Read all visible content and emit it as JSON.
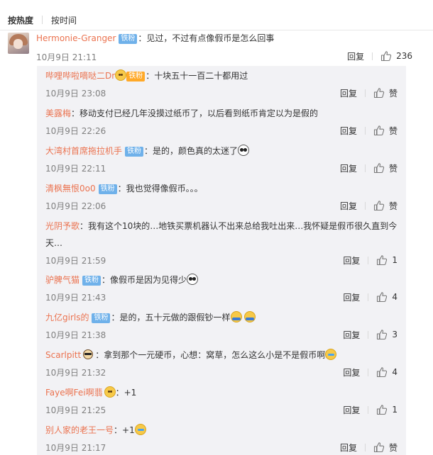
{
  "sort": {
    "hot": "按热度",
    "time": "按时间"
  },
  "main": {
    "user": "Hermonie-Granger",
    "badge": "铁粉",
    "text": "：见过，不过有点像假币是怎么回事",
    "time": "10月9日 21:11",
    "reply": "回复",
    "likes": "236"
  },
  "replies": [
    {
      "user": "哔哩哔啦嘀哒二Dr",
      "badge": "铁粉",
      "badge_style": "gold",
      "text": "：十块五十一百二十都用过",
      "time": "10月9日 23:08",
      "reply": "回复",
      "likes": "赞"
    },
    {
      "user": "美露梅",
      "badge": "",
      "text": "：移动支付已经几年没摸过纸币了，以后看到纸币肯定以为是假的",
      "time": "10月9日 22:26",
      "reply": "回复",
      "likes": "赞"
    },
    {
      "user": "大湾村首席拖拉机手",
      "badge": "铁粉",
      "text": "：是的，颜色真的太迷了",
      "emoji": "panda-icon",
      "time": "10月9日 22:11",
      "reply": "回复",
      "likes": "赞"
    },
    {
      "user": "清枫無恨0o0",
      "badge": "铁粉",
      "text": "：我也觉得像假币。。。",
      "time": "10月9日 22:06",
      "reply": "回复",
      "likes": "赞"
    },
    {
      "user": "光阴予歌",
      "badge": "",
      "text": "：我有这个10块的…地铁买票机器认不出来总给我吐出来…我怀疑是假币很久直到今",
      "text2": "天…",
      "time": "10月9日 21:59",
      "reply": "回复",
      "likes": "1"
    },
    {
      "user": "驴脾气猫",
      "badge": "铁粉",
      "text": "：像假币是因为见得少",
      "emoji": "panda-icon",
      "time": "10月9日 21:43",
      "reply": "回复",
      "likes": "4"
    },
    {
      "user": "九亿girls的",
      "badge": "铁粉",
      "text": "：是的，五十元做的跟假钞一样",
      "emoji": "hug-icon",
      "time": "10月9日 21:38",
      "reply": "回复",
      "likes": "3"
    },
    {
      "user": "Scarlpitt",
      "badge": "",
      "text": "：拿到那个一元硬币，心想：窝草，怎么这么小是不是假币啊",
      "emoji": "cry-laugh-icon",
      "time": "10月9日 21:32",
      "reply": "回复",
      "likes": "4"
    },
    {
      "user": "Faye啊Fei啊翡",
      "badge": "",
      "text": "：+1",
      "time": "10月9日 21:25",
      "reply": "回复",
      "likes": "1"
    },
    {
      "user": "别人家的老王一号",
      "badge": "",
      "text": "：+1",
      "emoji": "cry-laugh-icon",
      "time": "10月9日 21:17",
      "reply": "回复",
      "likes": "赞"
    }
  ]
}
